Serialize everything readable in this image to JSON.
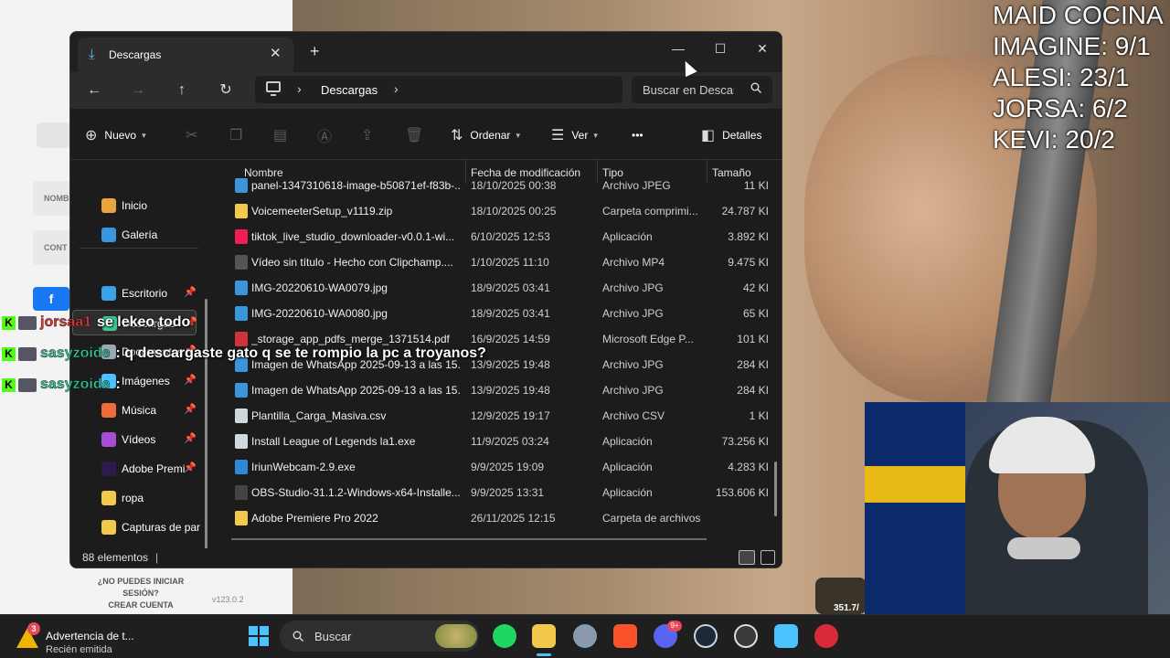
{
  "background": {
    "left_labels": [
      "NOMB",
      "CONT"
    ],
    "login_question": "¿NO PUEDES INICIAR SESIÓN?",
    "create_account": "CREAR CUENTA",
    "version": "v123.0.2",
    "overlay_badge": "351.7/"
  },
  "scoreboard": [
    "MAID COCINA",
    "IMAGINE: 9/1",
    "ALESI: 23/1",
    "JORSA: 6/2",
    "KEVI: 20/2"
  ],
  "chat": [
    {
      "user": "jorsaa1",
      "message": "se lekeo todo",
      "user_color": "#e03a3a"
    },
    {
      "user": "sasyzoide",
      "message": ": q descargaste gato q se te rompio la pc a troyanos?",
      "user_color": "#35c79a"
    },
    {
      "user": "sasyzoide",
      "message": ":",
      "user_color": "#35c79a"
    }
  ],
  "explorer": {
    "tab_title": "Descargas",
    "breadcrumb": "Descargas",
    "search_placeholder": "Buscar en Descargas",
    "commands": {
      "new": "Nuevo",
      "sort": "Ordenar",
      "view": "Ver",
      "more": "•••",
      "details": "Detalles"
    },
    "sidebar": [
      {
        "label": "Inicio",
        "icon": "home-icon",
        "pinned": false
      },
      {
        "label": "Galería",
        "icon": "gallery-icon",
        "pinned": false
      },
      {
        "label": "Escritorio",
        "icon": "desktop-icon",
        "pinned": true
      },
      {
        "label": "Descargas",
        "icon": "download-icon",
        "pinned": true,
        "selected": true
      },
      {
        "label": "Documentos",
        "icon": "documents-icon",
        "pinned": true
      },
      {
        "label": "Imágenes",
        "icon": "pictures-icon",
        "pinned": true
      },
      {
        "label": "Música",
        "icon": "music-icon",
        "pinned": true
      },
      {
        "label": "Vídeos",
        "icon": "videos-icon",
        "pinned": true
      },
      {
        "label": "Adobe Premi",
        "icon": "premiere-icon",
        "pinned": true
      },
      {
        "label": "ropa",
        "icon": "folder-icon",
        "pinned": false
      },
      {
        "label": "Capturas de par",
        "icon": "folder-icon",
        "pinned": false
      }
    ],
    "columns": {
      "name": "Nombre",
      "date": "Fecha de modificación",
      "type": "Tipo",
      "size": "Tamaño"
    },
    "files": [
      {
        "name": "panel-1347310618-image-b50871ef-f83b-...",
        "date": "18/10/2025 00:38",
        "type": "Archivo JPEG",
        "size": "11 KI",
        "icon": "image-file-icon"
      },
      {
        "name": "VoicemeeterSetup_v1119.zip",
        "date": "18/10/2025 00:25",
        "type": "Carpeta comprimi...",
        "size": "24.787 KI",
        "icon": "zip-folder-icon"
      },
      {
        "name": "tiktok_live_studio_downloader-v0.0.1-wi...",
        "date": "6/10/2025 12:53",
        "type": "Aplicación",
        "size": "3.892 KI",
        "icon": "tiktok-app-icon"
      },
      {
        "name": "Vídeo sin título - Hecho con Clipchamp....",
        "date": "1/10/2025 11:10",
        "type": "Archivo MP4",
        "size": "9.475 KI",
        "icon": "video-file-icon"
      },
      {
        "name": "IMG-20220610-WA0079.jpg",
        "date": "18/9/2025 03:41",
        "type": "Archivo JPG",
        "size": "42 KI",
        "icon": "image-file-icon"
      },
      {
        "name": "IMG-20220610-WA0080.jpg",
        "date": "18/9/2025 03:41",
        "type": "Archivo JPG",
        "size": "65 KI",
        "icon": "image-file-icon"
      },
      {
        "name": "_storage_app_pdfs_merge_1371514.pdf",
        "date": "16/9/2025 14:59",
        "type": "Microsoft Edge P...",
        "size": "101 KI",
        "icon": "pdf-file-icon"
      },
      {
        "name": "Imagen de WhatsApp 2025-09-13 a las 15...",
        "date": "13/9/2025 19:48",
        "type": "Archivo JPG",
        "size": "284 KI",
        "icon": "image-file-icon"
      },
      {
        "name": "Imagen de WhatsApp 2025-09-13 a las 15...",
        "date": "13/9/2025 19:48",
        "type": "Archivo JPG",
        "size": "284 KI",
        "icon": "image-file-icon"
      },
      {
        "name": "Plantilla_Carga_Masiva.csv",
        "date": "12/9/2025 19:17",
        "type": "Archivo CSV",
        "size": "1 KI",
        "icon": "csv-file-icon"
      },
      {
        "name": "Install League of Legends la1.exe",
        "date": "11/9/2025 03:24",
        "type": "Aplicación",
        "size": "73.256 KI",
        "icon": "exe-file-icon"
      },
      {
        "name": "IriunWebcam-2.9.exe",
        "date": "9/9/2025 19:09",
        "type": "Aplicación",
        "size": "4.283 KI",
        "icon": "iriun-app-icon"
      },
      {
        "name": "OBS-Studio-31.1.2-Windows-x64-Installe...",
        "date": "9/9/2025 13:31",
        "type": "Aplicación",
        "size": "153.606 KI",
        "icon": "obs-app-icon"
      },
      {
        "name": "Adobe Premiere Pro 2022",
        "date": "26/11/2025 12:15",
        "type": "Carpeta de archivos",
        "size": "",
        "icon": "folder-icon"
      }
    ],
    "status": "88 elementos"
  },
  "taskbar": {
    "notification_title": "Advertencia de t...",
    "notification_subtitle": "Recién emitida",
    "notification_count": "3",
    "search_placeholder": "Buscar",
    "discord_badge": "9+"
  },
  "colors": {
    "accent": "#4cc2ff",
    "window_bg": "#1c1c1c",
    "kick_green": "#53fc18"
  }
}
